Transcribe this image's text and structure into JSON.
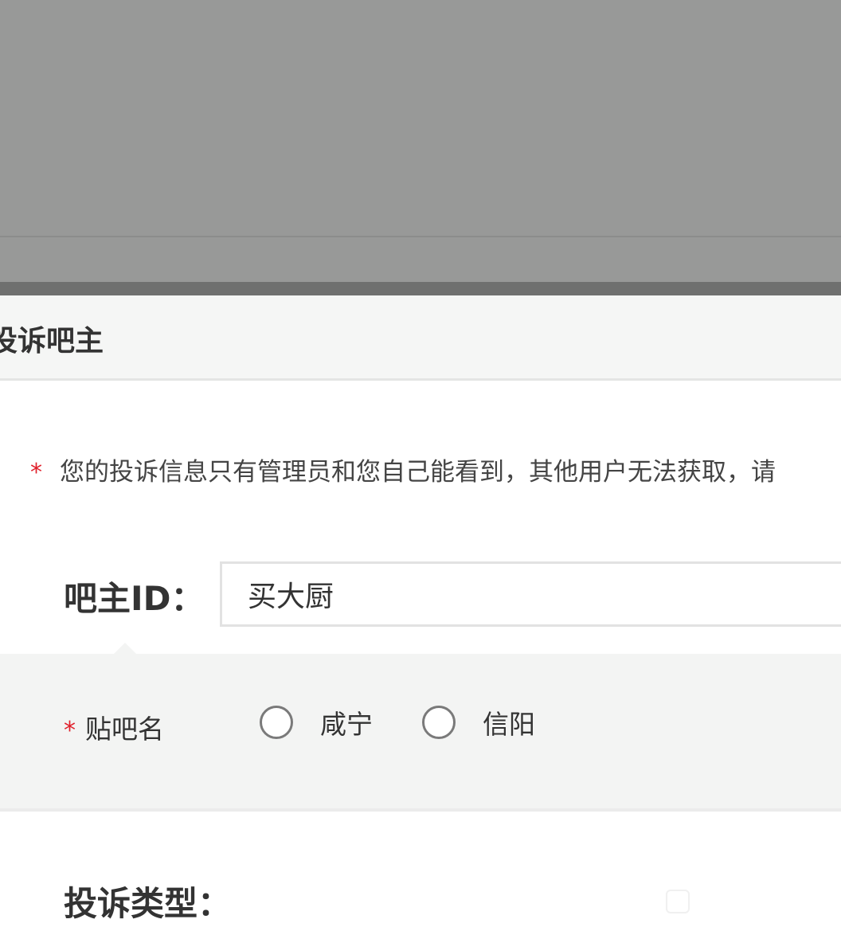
{
  "modal": {
    "title": "投诉吧主",
    "notice_star": "*",
    "notice_text": "您的投诉信息只有管理员和您自己能看到，其他用户无法获取，请"
  },
  "owner_field": {
    "label": "吧主ID：",
    "value": "买大厨"
  },
  "forum_select": {
    "star": "*",
    "label": "贴吧名",
    "options": [
      {
        "label": "咸宁",
        "selected": false
      },
      {
        "label": "信阳",
        "selected": false
      }
    ]
  },
  "complaint_type": {
    "label": "投诉类型："
  },
  "icons": {
    "image_placeholder": "image-icon"
  },
  "colors": {
    "required_star": "#e0202b",
    "overlay": "#989998",
    "header_bg": "#f5f6f5"
  }
}
